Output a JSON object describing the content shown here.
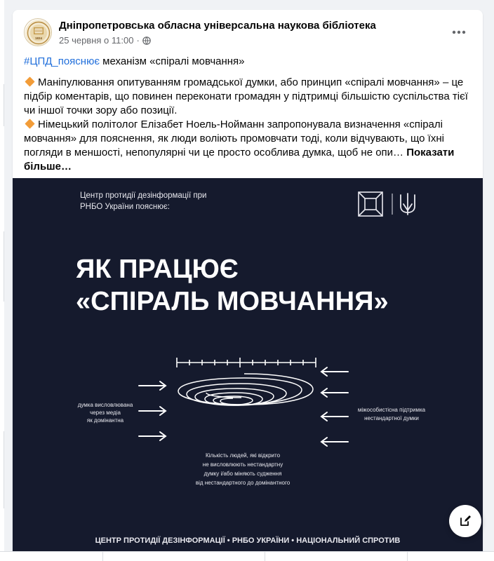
{
  "post": {
    "page_name": "Дніпропетровська обласна універсальна наукова бібліотека",
    "date": "25 червня о 11:00",
    "separator": "·",
    "hashtag": "#ЦПД_пояснює",
    "headline_rest": " механізм «спіралі мовчання»",
    "paragraph1": "Маніпулювання опитуванням громадської думки, або принцип «спіралі мовчання» – це підбір коментарів, що повинен переконати громадян у підтримці більшістю суспільства тієї чи іншої точки зору або позиції.",
    "paragraph2": "Німецький політолог Елізабет Ноель-Нойманн запропонувала визначення «спіралі мовчання» для пояснення, як люди воліють промовчати тоді, коли відчувають, що їхні погляди в меншості, непопулярні чи це просто особлива думка, щоб не опи…",
    "see_more": "Показати більше…",
    "avatar_year": "1834"
  },
  "image": {
    "top_text_line1": "Центр протидії дезінформації при",
    "top_text_line2": "РНБО України пояснює:",
    "title_line1": "ЯК ПРАЦЮЄ",
    "title_line2": "«СПІРАЛЬ МОВЧАННЯ»",
    "left_label_line1": "думка висловлювана",
    "left_label_line2": "через медіа",
    "left_label_line3": "як домінантна",
    "right_label_line1": "міжособистісна підтримка",
    "right_label_line2": "нестандартної думки",
    "bottom_label_line1": "Кількість людей, які відкрито",
    "bottom_label_line2": "не висловлюють нестандартну",
    "bottom_label_line3": "думку і/або міняють судження",
    "bottom_label_line4": "від нестандартного до домінантного",
    "footer": "ЦЕНТР ПРОТИДІЇ ДЕЗІНФОРМАЦІЇ • РНБО УКРАЇНИ • НАЦІОНАЛЬНИЙ СПРОТИВ",
    "background_color": "#151a2d"
  },
  "icons": {
    "more": "more-horizontal-icon",
    "globe": "globe-icon",
    "compose": "compose-icon"
  }
}
